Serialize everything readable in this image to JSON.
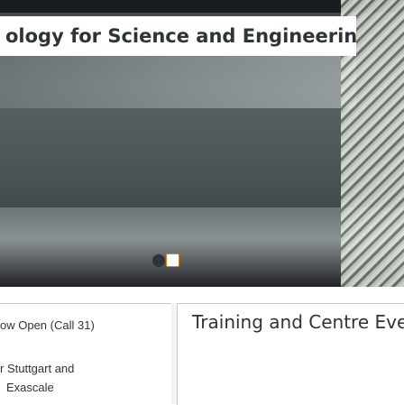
{
  "hero": {
    "title": "ology for Science and Engineering"
  },
  "cards": {
    "left": {
      "line1": "ow Open (Call 31)",
      "line2": "r Stuttgart and",
      "line3": "Exascale"
    },
    "right": {
      "title": "Training and Centre Even"
    }
  },
  "colors": {
    "accent": "#e07b1a",
    "text": "#2f3436"
  }
}
